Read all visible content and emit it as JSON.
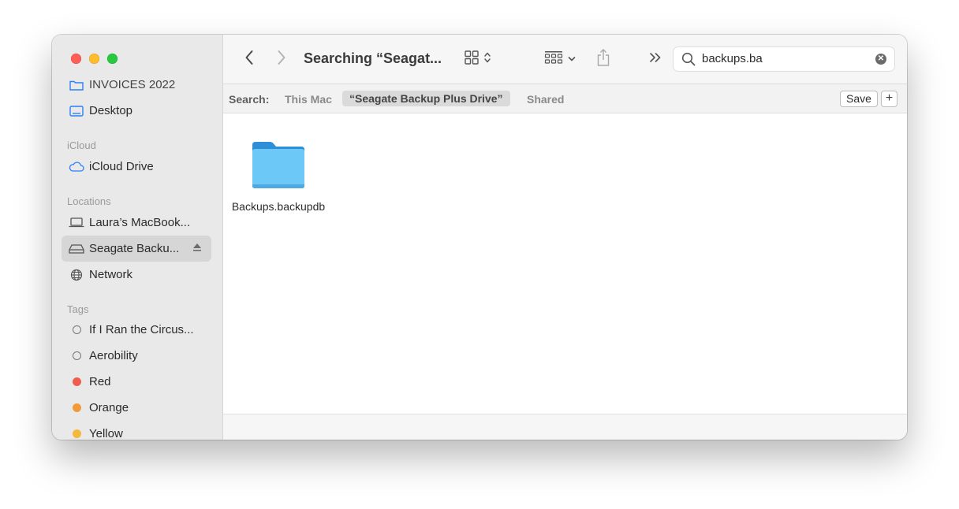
{
  "window": {
    "title": "Searching “Seagat..."
  },
  "sidebar": {
    "items_top": [
      {
        "label": "INVOICES 2022",
        "icon": "folder-icon"
      },
      {
        "label": "Desktop",
        "icon": "desktop-icon"
      }
    ],
    "icloud_header": "iCloud",
    "icloud_items": [
      {
        "label": "iCloud Drive",
        "icon": "cloud-icon"
      }
    ],
    "locations_header": "Locations",
    "locations_items": [
      {
        "label": "Laura’s MacBook...",
        "icon": "laptop-icon"
      },
      {
        "label": "Seagate Backu...",
        "icon": "external-drive-icon",
        "selected": true
      },
      {
        "label": "Network",
        "icon": "network-globe-icon"
      }
    ],
    "tags_header": "Tags",
    "tags": [
      {
        "label": "If I Ran the Circus...",
        "color": ""
      },
      {
        "label": "Aerobility",
        "color": ""
      },
      {
        "label": "Red",
        "color": "#ee5e4e"
      },
      {
        "label": "Orange",
        "color": "#f19a37"
      },
      {
        "label": "Yellow",
        "color": "#f4b93a"
      }
    ]
  },
  "search": {
    "value": "backups.ba"
  },
  "scope": {
    "label": "Search:",
    "options": [
      "This Mac",
      "“Seagate Backup Plus Drive”",
      "Shared"
    ],
    "selected": "“Seagate Backup Plus Drive”",
    "save_label": "Save",
    "add_label": "+"
  },
  "results": [
    {
      "name": "Backups.backupdb",
      "icon": "folder-icon"
    }
  ],
  "colors": {
    "folder": "#5ac1f5",
    "sidebar_bg": "#e9e9e9",
    "selected_row": "#d6d6d6"
  }
}
